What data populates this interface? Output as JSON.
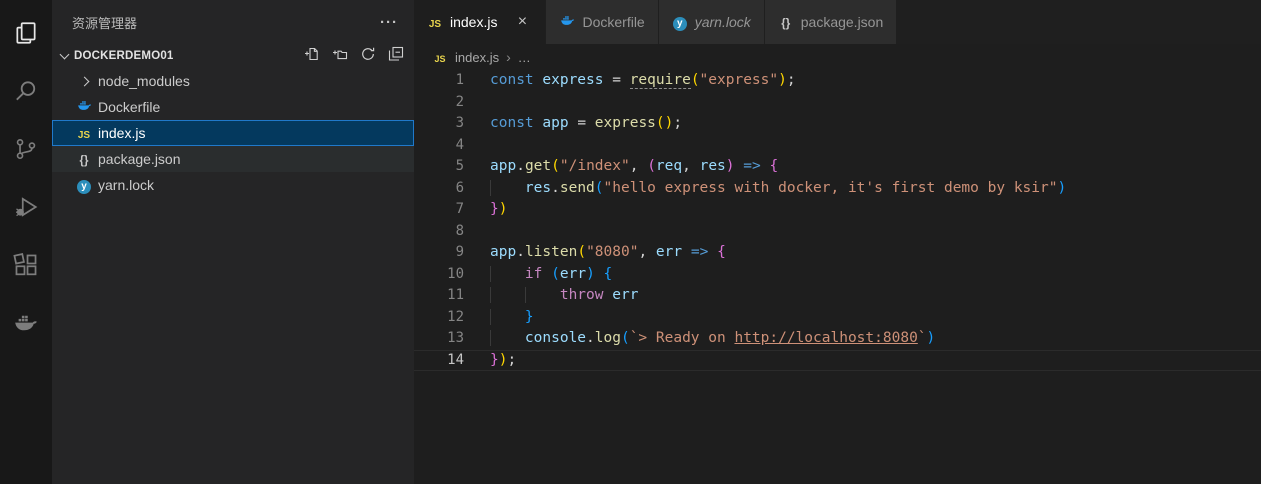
{
  "activity_bar": {
    "items": [
      {
        "name": "explorer",
        "active": true
      },
      {
        "name": "search",
        "active": false
      },
      {
        "name": "source-control",
        "active": false
      },
      {
        "name": "run-debug",
        "active": false
      },
      {
        "name": "extensions",
        "active": false
      },
      {
        "name": "docker",
        "active": false
      }
    ]
  },
  "sidebar": {
    "title": "资源管理器",
    "more_label": "···",
    "section": {
      "label": "DOCKERDEMO01",
      "actions": [
        "new-file",
        "new-folder",
        "refresh",
        "collapse-all"
      ]
    },
    "files": [
      {
        "label": "node_modules",
        "kind": "folder",
        "collapsed": true
      },
      {
        "label": "Dockerfile",
        "icon": "docker"
      },
      {
        "label": "index.js",
        "icon": "js",
        "selected": true
      },
      {
        "label": "package.json",
        "icon": "json",
        "hover": true
      },
      {
        "label": "yarn.lock",
        "icon": "yarn"
      }
    ]
  },
  "tabs": [
    {
      "label": "index.js",
      "icon": "js",
      "active": true,
      "close_label": "×"
    },
    {
      "label": "Dockerfile",
      "icon": "docker",
      "active": false
    },
    {
      "label": "yarn.lock",
      "icon": "yarn",
      "active": false,
      "preview": true
    },
    {
      "label": "package.json",
      "icon": "json",
      "active": false
    }
  ],
  "breadcrumb": {
    "icon": "js",
    "file": "index.js",
    "separator": "›",
    "ellipsis": "…"
  },
  "syntax_colors": {
    "kw": "#569cd6",
    "ctrl": "#c586c0",
    "var": "#9cdcfe",
    "fn": "#dcdcaa",
    "str": "#ce9178",
    "pn": "#d4d4d4",
    "b1": "#ffd700",
    "b2": "#da70d6",
    "b3": "#179fff",
    "line_number": "#858585",
    "line_number_active": "#c6c6c6"
  },
  "colors": {
    "activity_bar_bg": "#181818",
    "sidebar_bg": "#252526",
    "editor_bg": "#1e1e1e",
    "tab_inactive_bg": "#2d2d2d",
    "tab_active_bg": "#1e1e1e",
    "selection_bg": "#04395e",
    "selection_border": "#2079ca",
    "js_yellow": "#e8d44d",
    "docker_blue": "#2496ed",
    "yarn_blue": "#2c8ebb"
  },
  "editor": {
    "lines": [
      {
        "n": 1,
        "tokens": [
          [
            "kw",
            "const"
          ],
          [
            "pn",
            " "
          ],
          [
            "var",
            "express"
          ],
          [
            "pn",
            " = "
          ],
          [
            "fn",
            "require",
            "u"
          ],
          [
            "b1",
            "("
          ],
          [
            "str",
            "\"express\""
          ],
          [
            "b1",
            ")"
          ],
          [
            "pn",
            ";"
          ]
        ]
      },
      {
        "n": 2,
        "tokens": []
      },
      {
        "n": 3,
        "tokens": [
          [
            "kw",
            "const"
          ],
          [
            "pn",
            " "
          ],
          [
            "var",
            "app"
          ],
          [
            "pn",
            " = "
          ],
          [
            "fn",
            "express"
          ],
          [
            "b1",
            "()"
          ],
          [
            "pn",
            ";"
          ]
        ]
      },
      {
        "n": 4,
        "tokens": []
      },
      {
        "n": 5,
        "tokens": [
          [
            "var",
            "app"
          ],
          [
            "pn",
            "."
          ],
          [
            "fn",
            "get"
          ],
          [
            "b1",
            "("
          ],
          [
            "str",
            "\"/index\""
          ],
          [
            "pn",
            ", "
          ],
          [
            "b2",
            "("
          ],
          [
            "var",
            "req"
          ],
          [
            "pn",
            ", "
          ],
          [
            "var",
            "res"
          ],
          [
            "b2",
            ")"
          ],
          [
            "pn",
            " "
          ],
          [
            "kw",
            "=>"
          ],
          [
            "pn",
            " "
          ],
          [
            "b2",
            "{"
          ]
        ]
      },
      {
        "n": 6,
        "tokens": [
          [
            "ind",
            "    "
          ],
          [
            "var",
            "res"
          ],
          [
            "pn",
            "."
          ],
          [
            "fn",
            "send"
          ],
          [
            "b3",
            "("
          ],
          [
            "str",
            "\"hello express with docker, it's first demo by ksir\""
          ],
          [
            "b3",
            ")"
          ]
        ]
      },
      {
        "n": 7,
        "tokens": [
          [
            "b2",
            "}"
          ],
          [
            "b1",
            ")"
          ]
        ]
      },
      {
        "n": 8,
        "tokens": []
      },
      {
        "n": 9,
        "tokens": [
          [
            "var",
            "app"
          ],
          [
            "pn",
            "."
          ],
          [
            "fn",
            "listen"
          ],
          [
            "b1",
            "("
          ],
          [
            "str",
            "\"8080\""
          ],
          [
            "pn",
            ", "
          ],
          [
            "var",
            "err"
          ],
          [
            "pn",
            " "
          ],
          [
            "kw",
            "=>"
          ],
          [
            "pn",
            " "
          ],
          [
            "b2",
            "{"
          ]
        ]
      },
      {
        "n": 10,
        "tokens": [
          [
            "ind",
            "    "
          ],
          [
            "ctrl",
            "if"
          ],
          [
            "pn",
            " "
          ],
          [
            "b3",
            "("
          ],
          [
            "var",
            "err"
          ],
          [
            "b3",
            ")"
          ],
          [
            "pn",
            " "
          ],
          [
            "b3",
            "{"
          ]
        ]
      },
      {
        "n": 11,
        "tokens": [
          [
            "ind",
            "    "
          ],
          [
            "ind",
            "    "
          ],
          [
            "ctrl",
            "throw"
          ],
          [
            "pn",
            " "
          ],
          [
            "var",
            "err"
          ]
        ]
      },
      {
        "n": 12,
        "tokens": [
          [
            "ind",
            "    "
          ],
          [
            "b3",
            "}"
          ]
        ]
      },
      {
        "n": 13,
        "tokens": [
          [
            "ind",
            "    "
          ],
          [
            "var",
            "console"
          ],
          [
            "pn",
            "."
          ],
          [
            "fn",
            "log"
          ],
          [
            "b3",
            "("
          ],
          [
            "str",
            "`> Ready on "
          ],
          [
            "str",
            "http://localhost:8080",
            "lnk"
          ],
          [
            "str",
            "`"
          ],
          [
            "b3",
            ")"
          ]
        ]
      },
      {
        "n": 14,
        "current": true,
        "tokens": [
          [
            "b2",
            "}"
          ],
          [
            "b1",
            ")"
          ],
          [
            "pn",
            ";"
          ]
        ]
      }
    ]
  }
}
